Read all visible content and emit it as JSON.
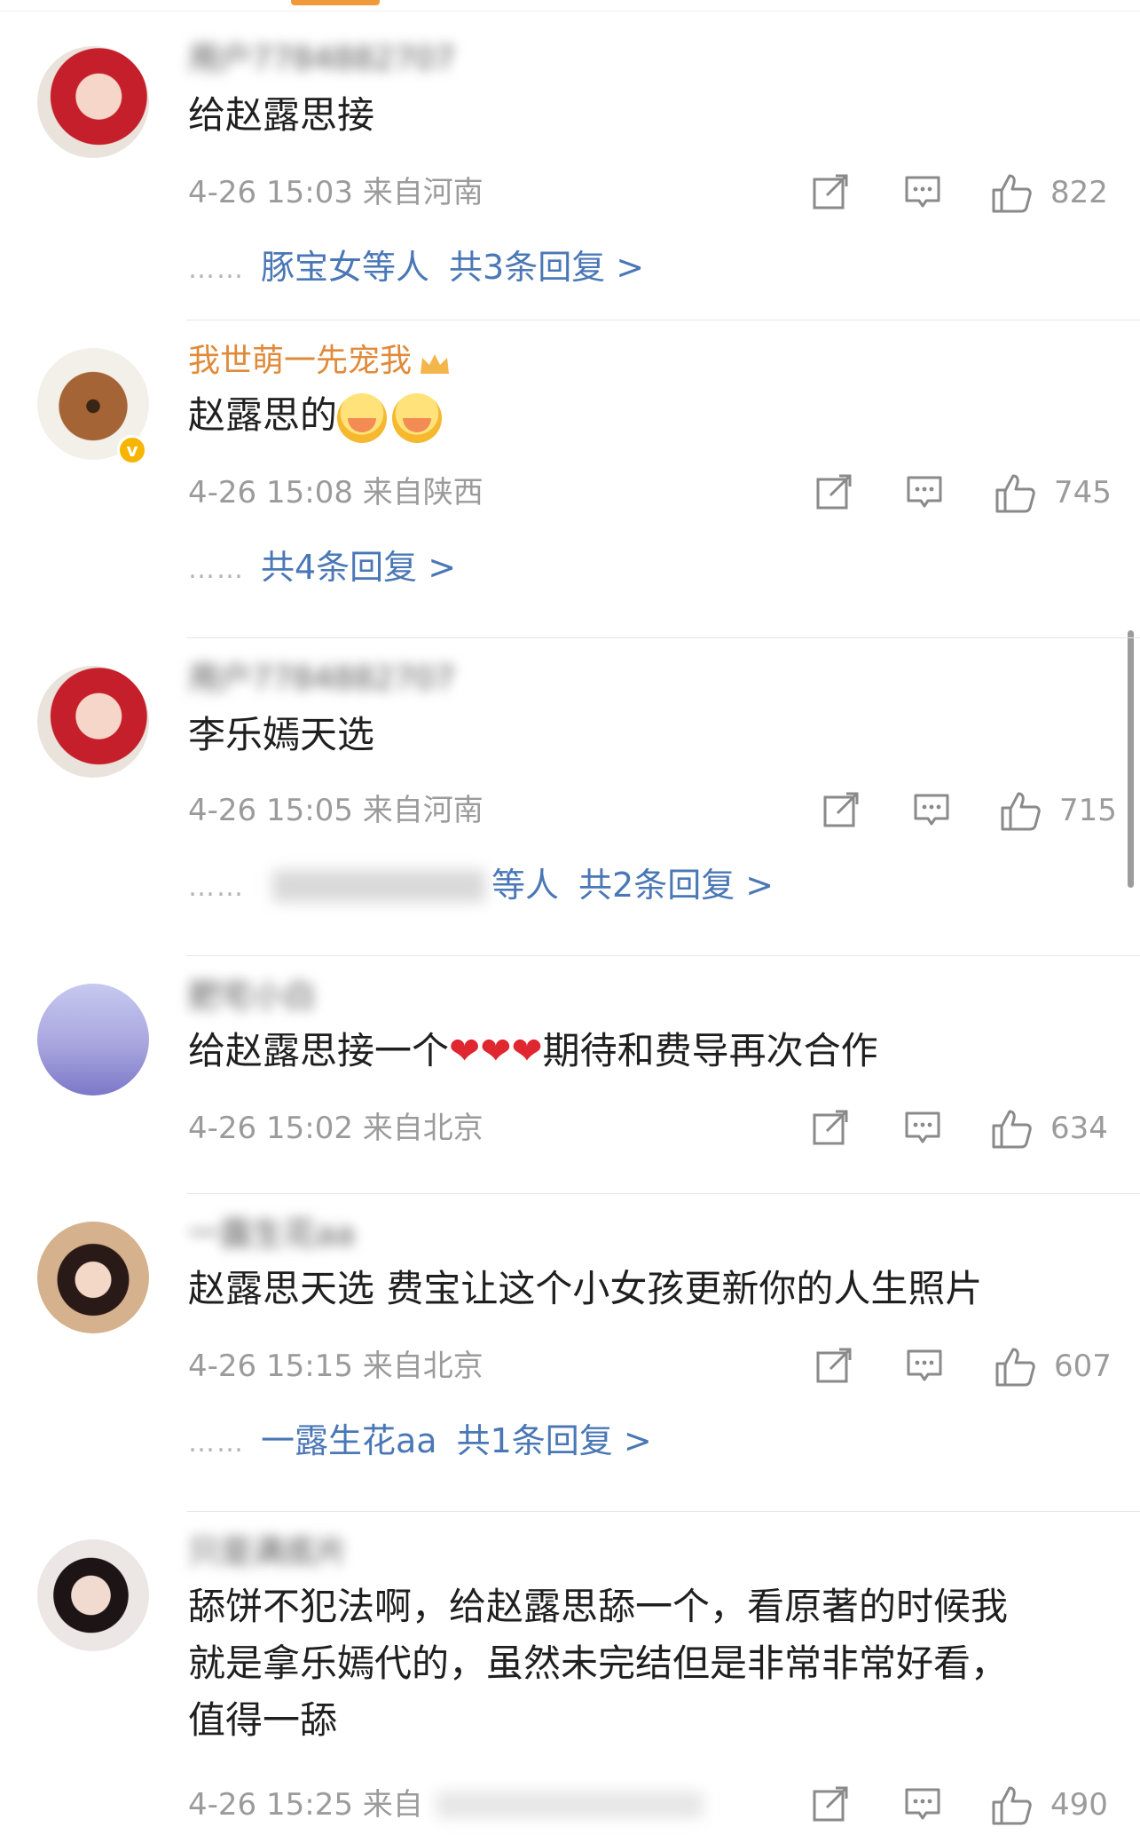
{
  "comments": [
    {
      "username": "用户7784882707",
      "text": "给赵露思接",
      "timestamp": "4-26 15:03 来自河南",
      "likes": "822",
      "reply_users": "豚宝女等人",
      "reply_count": "共3条回复 >"
    },
    {
      "username": "我世萌一先宠我",
      "text": "赵露思的",
      "emojis": [
        "scared-emoji",
        "scared-emoji"
      ],
      "timestamp": "4-26 15:08 来自陕西",
      "likes": "745",
      "reply_users": "",
      "reply_count": "共4条回复 >"
    },
    {
      "username": "用户7784882707",
      "text": "李乐嫣天选",
      "timestamp": "4-26 15:05 来自河南",
      "likes": "715",
      "reply_users": "等人",
      "reply_count": "共2条回复 >"
    },
    {
      "username": "肥宅小白",
      "text_before": "给赵露思接一个",
      "hearts": "❤❤❤",
      "text_after": "期待和费导再次合作",
      "timestamp": "4-26 15:02 来自北京",
      "likes": "634"
    },
    {
      "username": "一露生花aa",
      "text": "赵露思天选 费宝让这个小女孩更新你的人生照片",
      "timestamp": "4-26 15:15 来自北京",
      "likes": "607",
      "reply_users": "一露生花aa",
      "reply_count": "共1条回复 >"
    },
    {
      "username": "只是满底片",
      "text_lines": [
        "舔饼不犯法啊，给赵露思舔一个，看原著的时候我",
        "就是拿乐嫣代的，虽然未完结但是非常非常好看，",
        "值得一舔"
      ],
      "timestamp": "4-26 15:25 来自",
      "likes": "490"
    }
  ],
  "icons": {
    "share": "share-icon",
    "comment": "comment-icon",
    "like": "thumbs-up-icon",
    "verified": "verified-v-icon"
  },
  "colors": {
    "link": "#4a77b5",
    "meta": "#9b9b9b",
    "vip_name": "#e08a3a",
    "heart": "#e0262f"
  }
}
